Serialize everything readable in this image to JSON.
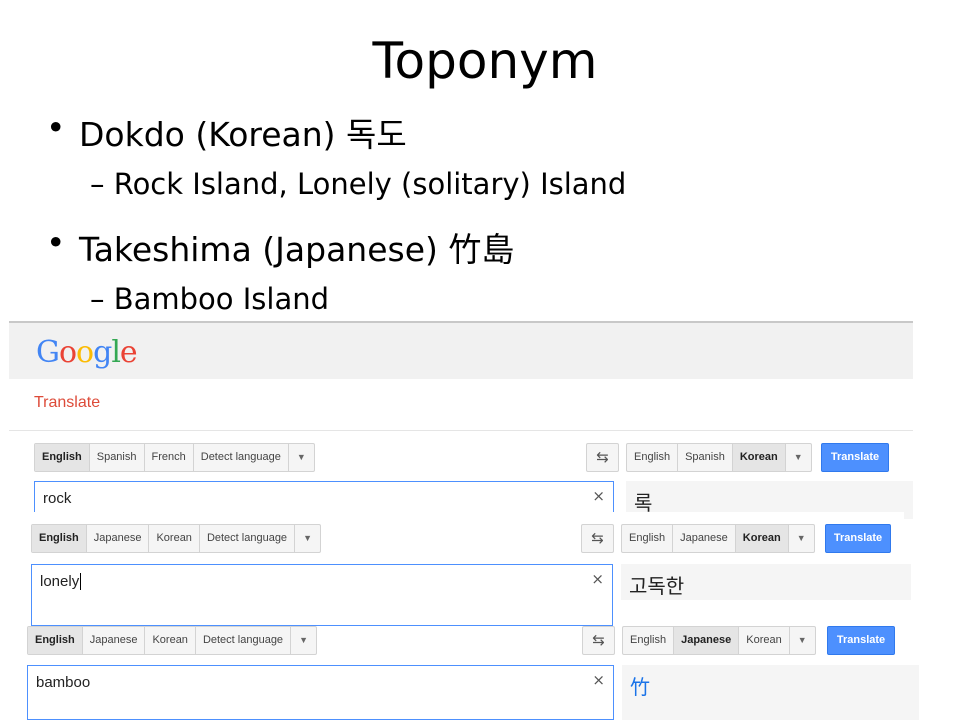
{
  "slide": {
    "title": "Toponym",
    "bullets": [
      {
        "text": "Dokdo (Korean) 독도",
        "sub": "– Rock Island, Lonely (solitary) Island"
      },
      {
        "text": "Takeshima (Japanese) 竹島",
        "sub": "– Bamboo Island"
      }
    ],
    "bullet_glyph": "•"
  },
  "google": {
    "logo": {
      "letters": [
        "G",
        "o",
        "o",
        "g",
        "l",
        "e"
      ],
      "colors": [
        "#4285f4",
        "#ea4335",
        "#fbbc05",
        "#4285f4",
        "#34a853",
        "#ea4335"
      ]
    },
    "app_title": "Translate",
    "translate_label": "Translate",
    "swap_icon": "swap-arrows-icon",
    "clear_icon": "×",
    "dropdown_arrow": "▼",
    "swap_glyph": "⇆"
  },
  "panels": [
    {
      "source_langs": [
        "English",
        "Spanish",
        "French",
        "Detect language"
      ],
      "source_selected": 0,
      "target_langs": [
        "English",
        "Spanish",
        "Korean"
      ],
      "target_selected": 2,
      "input": "rock",
      "output": "록"
    },
    {
      "source_langs": [
        "English",
        "Japanese",
        "Korean",
        "Detect language"
      ],
      "source_selected": 0,
      "target_langs": [
        "English",
        "Japanese",
        "Korean"
      ],
      "target_selected": 2,
      "input": "lonely",
      "output": "고독한"
    },
    {
      "source_langs": [
        "English",
        "Japanese",
        "Korean",
        "Detect language"
      ],
      "source_selected": 0,
      "target_langs": [
        "English",
        "Japanese",
        "Korean"
      ],
      "target_selected": 1,
      "input": "bamboo",
      "output": "竹"
    }
  ],
  "colors": {
    "accent": "#4d90fe",
    "translate_red": "#dd4b39"
  }
}
